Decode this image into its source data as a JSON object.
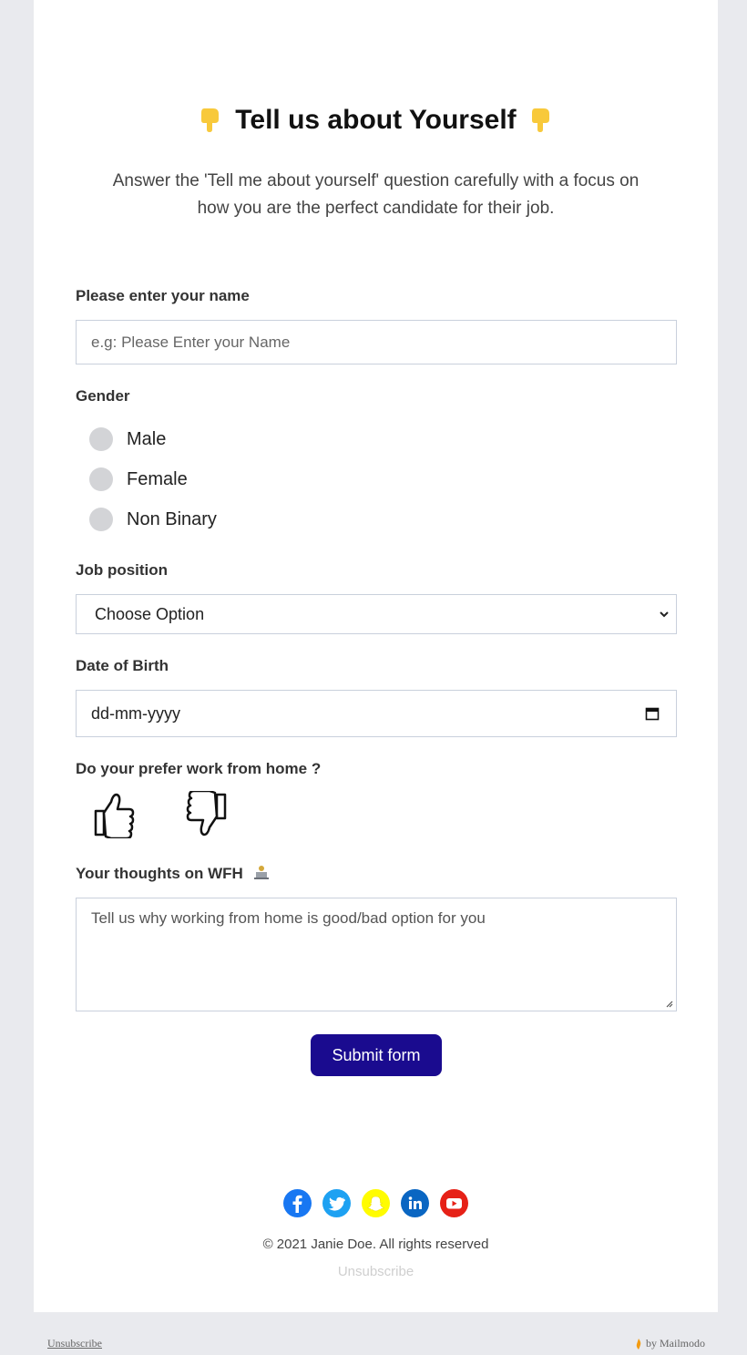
{
  "header": {
    "title": "Tell us about Yourself",
    "title_emoji": "pointing-down-emoji",
    "subtitle_line1": "Answer the 'Tell me about yourself' question carefully with a focus on",
    "subtitle_line2": "how you are the perfect candidate for their job."
  },
  "form": {
    "name_label": "Please enter your name",
    "name_placeholder": "e.g: Please Enter your Name",
    "gender_label": "Gender",
    "gender_options": [
      "Male",
      "Female",
      "Non Binary"
    ],
    "job_label": "Job position",
    "job_selected": "Choose Option",
    "dob_label": "Date of Birth",
    "dob_value": "dd-mm-yyyy",
    "wfh_label": "Do your prefer work from home ?",
    "thoughts_label": "Your thoughts on WFH",
    "thoughts_placeholder": "Tell us why working  from home is good/bad option for you",
    "submit_label": "Submit form"
  },
  "footer": {
    "socials": [
      "facebook-icon",
      "twitter-icon",
      "snapchat-icon",
      "linkedin-icon",
      "youtube-icon"
    ],
    "copyright": "© 2021 Janie Doe. All rights reserved",
    "unsubscribe": "Unsubscribe"
  },
  "page_footer": {
    "left": "Unsubscribe",
    "right": "by Mailmodo"
  },
  "colors": {
    "accent": "#1a0b8f",
    "facebook": "#1877f2",
    "twitter": "#1da1f2",
    "snapchat": "#fffc00",
    "linkedin": "#0a66c2",
    "youtube": "#e62117"
  }
}
